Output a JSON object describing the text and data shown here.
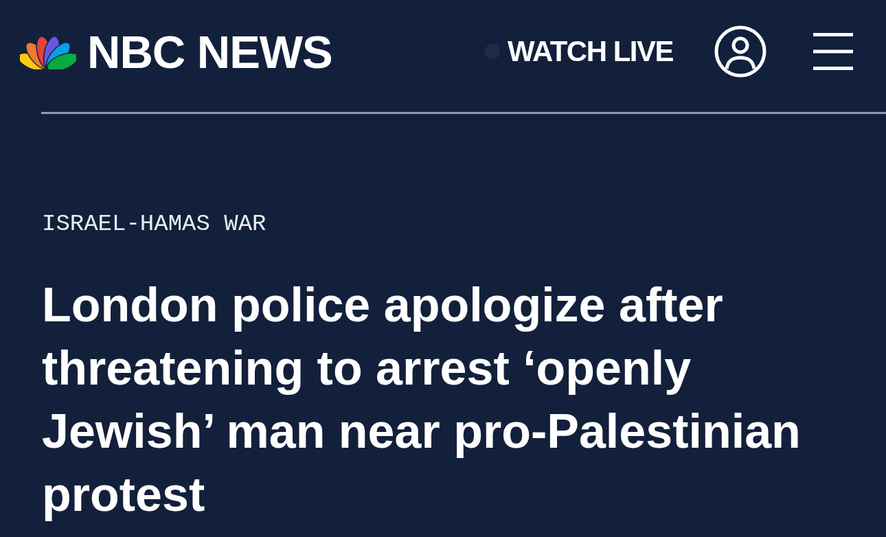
{
  "header": {
    "logo_text": "NBC NEWS",
    "watch_live": "WATCH LIVE"
  },
  "article": {
    "category": "ISRAEL-HAMAS WAR",
    "headline": "London police apologize after threatening to arrest ‘openly Jewish’ man near pro-Palestinian protest"
  }
}
